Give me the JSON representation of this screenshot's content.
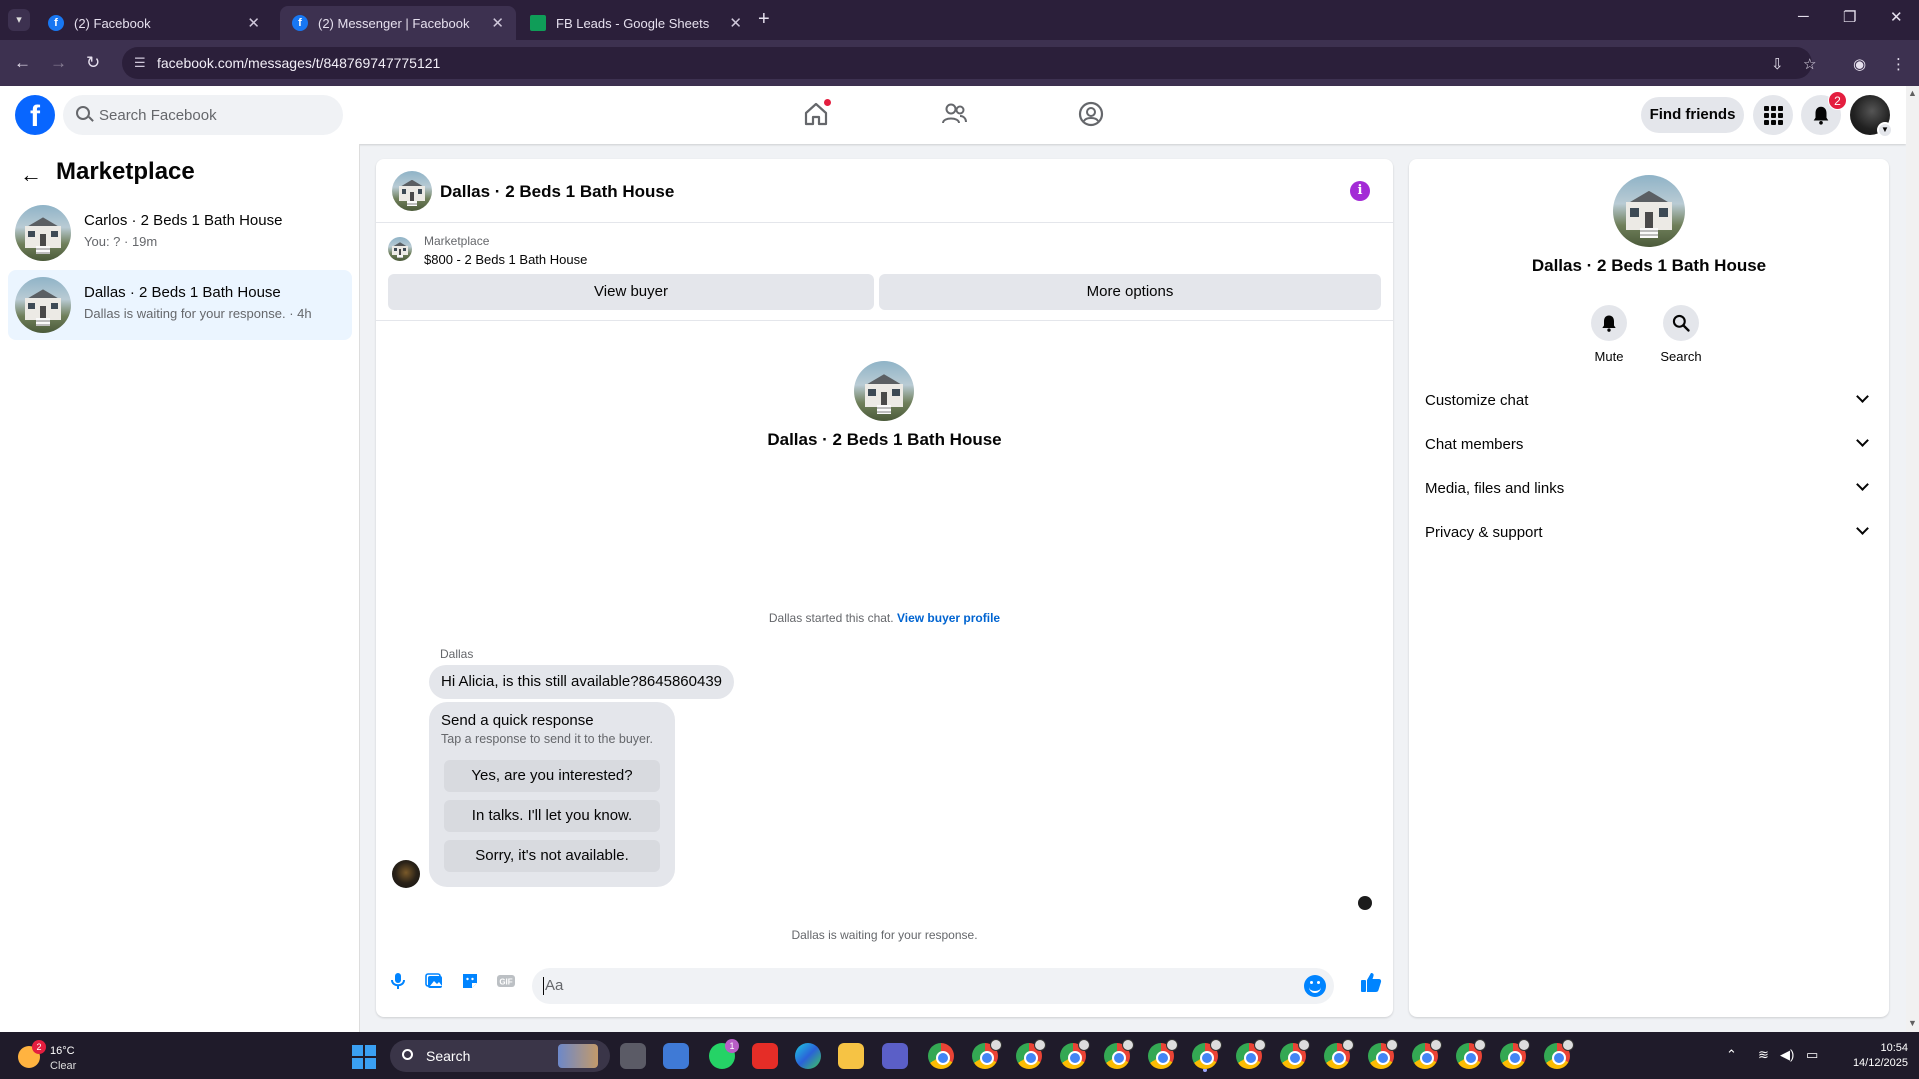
{
  "browser": {
    "tabs": [
      {
        "label": "(2) Facebook",
        "icon": "facebook-favicon"
      },
      {
        "label": "(2) Messenger | Facebook",
        "icon": "facebook-favicon"
      },
      {
        "label": "FB Leads - Google Sheets",
        "icon": "sheets-favicon"
      }
    ],
    "url": "facebook.com/messages/t/848769747775121"
  },
  "fb_header": {
    "logo_letter": "f",
    "search_placeholder": "Search Facebook",
    "find_friends_label": "Find friends",
    "notifications_count": "2"
  },
  "sidebar": {
    "title": "Marketplace",
    "conversations": [
      {
        "title": "Carlos · 2 Beds 1 Bath House",
        "subtitle": "You: ? · 19m"
      },
      {
        "title": "Dallas · 2 Beds 1 Bath House",
        "subtitle": "Dallas is waiting for your response. · 4h"
      }
    ]
  },
  "chat": {
    "header_title": "Dallas · 2 Beds 1 Bath House",
    "info_glyph": "i",
    "listing": {
      "source": "Marketplace",
      "price_title": "$800 - 2 Beds 1 Bath House",
      "view_buyer_label": "View buyer",
      "more_options_label": "More options"
    },
    "center_title": "Dallas · 2 Beds 1 Bath House",
    "started_text": "Dallas started this chat.",
    "view_profile_link": "View buyer profile",
    "sender_name": "Dallas",
    "message": "Hi Alicia, is this still available?8645860439",
    "quick_response": {
      "title": "Send a quick response",
      "subtitle": "Tap a response to send it to the buyer.",
      "options": [
        "Yes, are you interested?",
        "In talks. I'll let you know.",
        "Sorry, it's not available."
      ]
    },
    "waiting_text": "Dallas is waiting for your response.",
    "composer_placeholder": "Aa",
    "composer_icons": [
      "microphone-icon",
      "photo-icon",
      "sticker-icon",
      "gif-icon"
    ],
    "gif_label": "GIF",
    "accent_color": "#0084ff"
  },
  "details": {
    "title": "Dallas · 2 Beds 1 Bath House",
    "actions": [
      {
        "label": "Mute",
        "icon": "bell-icon"
      },
      {
        "label": "Search",
        "icon": "search-icon"
      }
    ],
    "sections": [
      "Customize chat",
      "Chat members",
      "Media, files and links",
      "Privacy & support"
    ]
  },
  "taskbar": {
    "weather_temp": "16°C",
    "weather_cond": "Clear",
    "weather_badge": "2",
    "search_label": "Search",
    "whatsapp_badge": "1",
    "time": "10:54",
    "date": "14/12/2025"
  }
}
